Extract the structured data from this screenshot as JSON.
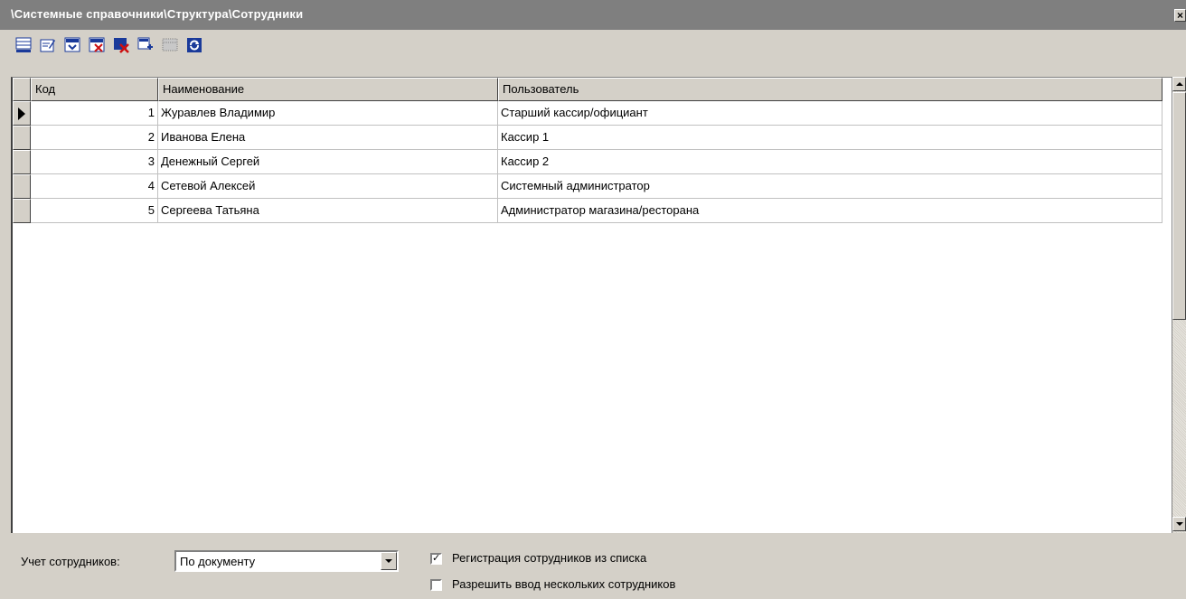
{
  "window": {
    "title": "\\Системные справочники\\Структура\\Сотрудники",
    "close_label": "×"
  },
  "toolbar": [
    {
      "name": "insert-record-icon"
    },
    {
      "name": "edit-record-icon"
    },
    {
      "name": "save-record-icon"
    },
    {
      "name": "cancel-record-icon"
    },
    {
      "name": "delete-record-icon"
    },
    {
      "name": "copy-record-icon"
    },
    {
      "name": "filter-icon"
    },
    {
      "name": "refresh-icon"
    }
  ],
  "grid": {
    "columns": [
      "Код",
      "Наименование",
      "Пользователь"
    ],
    "rows": [
      {
        "code": "1",
        "name": "Журавлев Владимир",
        "user": "Старший кассир/официант",
        "current": true
      },
      {
        "code": "2",
        "name": "Иванова Елена",
        "user": "Кассир 1"
      },
      {
        "code": "3",
        "name": "Денежный Сергей",
        "user": "Кассир 2"
      },
      {
        "code": "4",
        "name": "Сетевой Алексей",
        "user": "Системный администратор"
      },
      {
        "code": "5",
        "name": "Сергеева Татьяна",
        "user": "Администратор магазина/ресторана"
      }
    ]
  },
  "footer": {
    "accounting_label": "Учет сотрудников:",
    "accounting_value": "По документу",
    "register_from_list": {
      "label": "Регистрация сотрудников из списка",
      "checked": true
    },
    "allow_multiple": {
      "label": "Разрешить ввод нескольких сотрудников",
      "checked": false
    }
  },
  "colors": {
    "title_bg": "#7f7f7f",
    "window_bg": "#d4d0c8",
    "toolbar_blue": "#1a3a9a",
    "toolbar_red": "#cc1010"
  }
}
